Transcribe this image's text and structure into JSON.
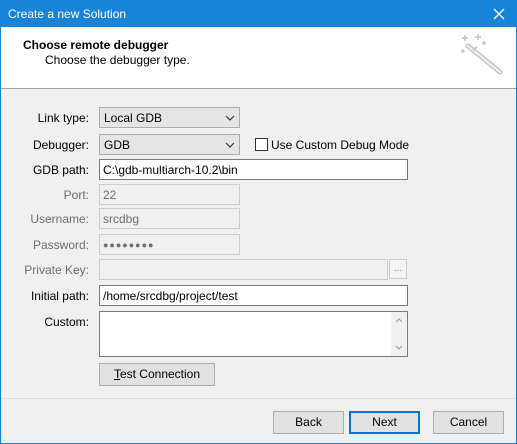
{
  "window": {
    "title": "Create a new Solution"
  },
  "header": {
    "title": "Choose remote debugger",
    "subtitle": "Choose the debugger type."
  },
  "form": {
    "link_type": {
      "label": "Link type:",
      "value": "Local GDB"
    },
    "debugger": {
      "label": "Debugger:",
      "value": "GDB"
    },
    "custom_debug_mode": {
      "label": "Use Custom Debug Mode",
      "checked": false
    },
    "gdb_path": {
      "label": "GDB path:",
      "value": "C:\\gdb-multiarch-10.2\\bin"
    },
    "port": {
      "label": "Port:",
      "value": "22"
    },
    "username": {
      "label": "Username:",
      "value": "srcdbg"
    },
    "password": {
      "label": "Password:",
      "value": "●●●●●●●●"
    },
    "private_key": {
      "label": "Private Key:",
      "value": "",
      "browse_label": "..."
    },
    "initial_path": {
      "label": "Initial path:",
      "value": "/home/srcdbg/project/test"
    },
    "custom": {
      "label": "Custom:",
      "value": ""
    },
    "test_connection": {
      "prefix": "",
      "mnemonic": "T",
      "rest": "est Connection"
    }
  },
  "footer": {
    "back_label": "Back",
    "next_label": "Next",
    "cancel_label": "Cancel"
  },
  "colors": {
    "titlebar": "#1883d7",
    "default_button_border": "#0078d7"
  }
}
